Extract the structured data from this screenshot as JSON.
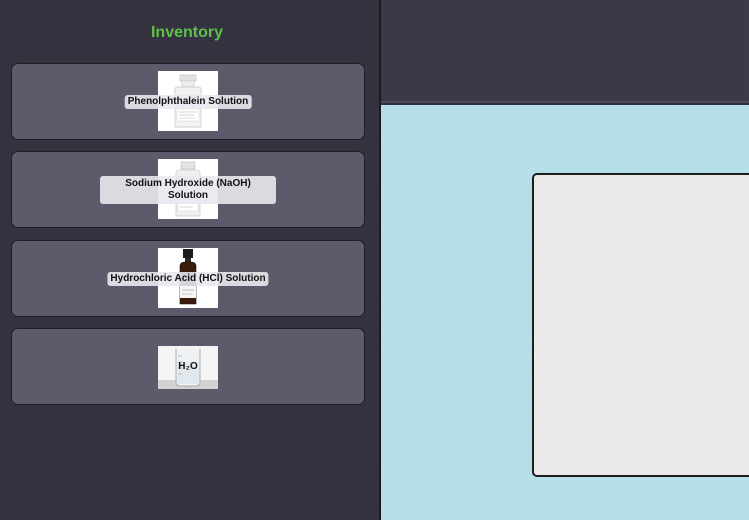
{
  "sidebar": {
    "title": "Inventory",
    "items": [
      {
        "label": "Phenolphthalein Solution"
      },
      {
        "label": "Sodium Hydroxide (NaOH) Solution"
      },
      {
        "label": "Hydrochloric Acid (HCl) Solution"
      },
      {
        "label": "H₂O"
      }
    ]
  },
  "colors": {
    "sidebar_bg": "#33313e",
    "card_bg": "#5d5b6b",
    "title_accent": "#5ec14a",
    "workspace_bg": "#b3dde7",
    "panel_bg": "#ececec"
  }
}
